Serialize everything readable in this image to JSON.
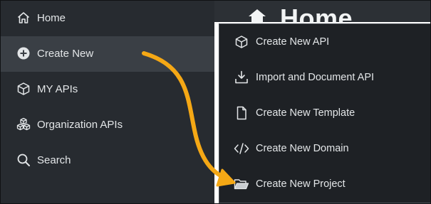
{
  "sidebar": {
    "items": [
      {
        "label": "Home",
        "icon": "home-icon"
      },
      {
        "label": "Create New",
        "icon": "plus-circle-icon"
      },
      {
        "label": "MY APIs",
        "icon": "cube-icon"
      },
      {
        "label": "Organization APIs",
        "icon": "cubes-icon"
      },
      {
        "label": "Search",
        "icon": "search-icon"
      }
    ]
  },
  "main": {
    "title": "Home"
  },
  "menu": {
    "items": [
      {
        "label": "Create New API",
        "icon": "cube-icon"
      },
      {
        "label": "Import and Document API",
        "icon": "import-icon"
      },
      {
        "label": "Create New Template",
        "icon": "file-icon"
      },
      {
        "label": "Create New Domain",
        "icon": "code-icon"
      },
      {
        "label": "Create New Project",
        "icon": "folder-open-icon"
      }
    ]
  },
  "colors": {
    "accent_arrow": "#f5a815",
    "sidebar_bg": "#272b30",
    "active_bg": "#3a3f45",
    "menu_bg": "#1e2125"
  }
}
